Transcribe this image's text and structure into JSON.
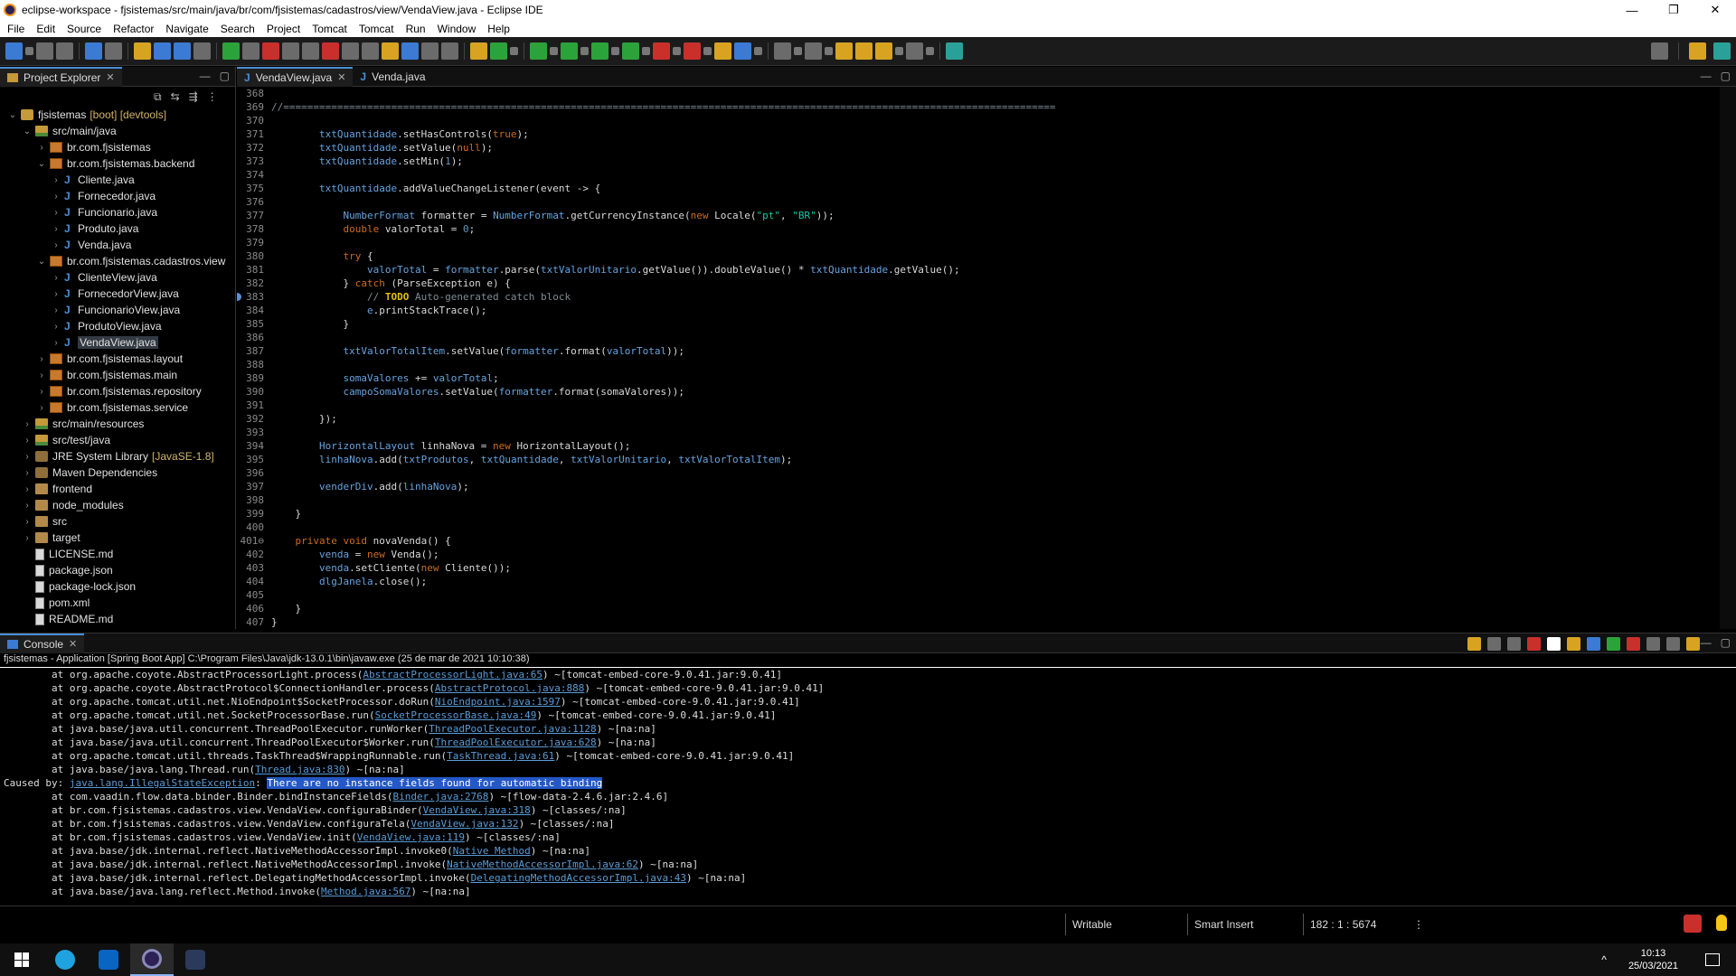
{
  "window": {
    "title": "eclipse-workspace - fjsistemas/src/main/java/br/com/fjsistemas/cadastros/view/VendaView.java - Eclipse IDE",
    "minimize": "—",
    "restore": "❐",
    "close": "✕"
  },
  "menu": [
    "File",
    "Edit",
    "Source",
    "Refactor",
    "Navigate",
    "Search",
    "Project",
    "Tomcat",
    "Tomcat",
    "Run",
    "Window",
    "Help"
  ],
  "explorer": {
    "tab_label": "Project Explorer",
    "tree": [
      {
        "depth": 0,
        "twisty": "v",
        "icon": "project",
        "label": "fjsistemas",
        "decoration": "[boot] [devtools]"
      },
      {
        "depth": 1,
        "twisty": "v",
        "icon": "srcfolder",
        "label": "src/main/java"
      },
      {
        "depth": 2,
        "twisty": ">",
        "icon": "package",
        "label": "br.com.fjsistemas"
      },
      {
        "depth": 2,
        "twisty": "v",
        "icon": "package",
        "label": "br.com.fjsistemas.backend"
      },
      {
        "depth": 3,
        "twisty": ">",
        "icon": "java",
        "label": "Cliente.java"
      },
      {
        "depth": 3,
        "twisty": ">",
        "icon": "java",
        "label": "Fornecedor.java"
      },
      {
        "depth": 3,
        "twisty": ">",
        "icon": "java",
        "label": "Funcionario.java"
      },
      {
        "depth": 3,
        "twisty": ">",
        "icon": "java",
        "label": "Produto.java"
      },
      {
        "depth": 3,
        "twisty": ">",
        "icon": "java",
        "label": "Venda.java"
      },
      {
        "depth": 2,
        "twisty": "v",
        "icon": "package",
        "label": "br.com.fjsistemas.cadastros.view"
      },
      {
        "depth": 3,
        "twisty": ">",
        "icon": "java",
        "label": "ClienteView.java"
      },
      {
        "depth": 3,
        "twisty": ">",
        "icon": "java",
        "label": "FornecedorView.java"
      },
      {
        "depth": 3,
        "twisty": ">",
        "icon": "java",
        "label": "FuncionarioView.java"
      },
      {
        "depth": 3,
        "twisty": ">",
        "icon": "java",
        "label": "ProdutoView.java"
      },
      {
        "depth": 3,
        "twisty": ">",
        "icon": "java",
        "label": "VendaView.java",
        "selected": true
      },
      {
        "depth": 2,
        "twisty": ">",
        "icon": "package",
        "label": "br.com.fjsistemas.layout"
      },
      {
        "depth": 2,
        "twisty": ">",
        "icon": "package",
        "label": "br.com.fjsistemas.main"
      },
      {
        "depth": 2,
        "twisty": ">",
        "icon": "package",
        "label": "br.com.fjsistemas.repository"
      },
      {
        "depth": 2,
        "twisty": ">",
        "icon": "package",
        "label": "br.com.fjsistemas.service"
      },
      {
        "depth": 1,
        "twisty": ">",
        "icon": "srcfolder",
        "label": "src/main/resources"
      },
      {
        "depth": 1,
        "twisty": ">",
        "icon": "srcfolder",
        "label": "src/test/java"
      },
      {
        "depth": 1,
        "twisty": ">",
        "icon": "library",
        "label": "JRE System Library",
        "decoration": "[JavaSE-1.8]"
      },
      {
        "depth": 1,
        "twisty": ">",
        "icon": "library",
        "label": "Maven Dependencies"
      },
      {
        "depth": 1,
        "twisty": ">",
        "icon": "folder",
        "label": "frontend"
      },
      {
        "depth": 1,
        "twisty": ">",
        "icon": "folder",
        "label": "node_modules"
      },
      {
        "depth": 1,
        "twisty": ">",
        "icon": "folder",
        "label": "src"
      },
      {
        "depth": 1,
        "twisty": ">",
        "icon": "folder",
        "label": "target"
      },
      {
        "depth": 1,
        "twisty": "",
        "icon": "file",
        "label": "LICENSE.md"
      },
      {
        "depth": 1,
        "twisty": "",
        "icon": "file",
        "label": "package.json"
      },
      {
        "depth": 1,
        "twisty": "",
        "icon": "file",
        "label": "package-lock.json"
      },
      {
        "depth": 1,
        "twisty": "",
        "icon": "file",
        "label": "pom.xml"
      },
      {
        "depth": 1,
        "twisty": "",
        "icon": "file",
        "label": "README.md"
      }
    ]
  },
  "editor": {
    "tabs": [
      {
        "label": "VendaView.java",
        "active": true
      },
      {
        "label": "Venda.java",
        "active": false
      }
    ],
    "lines": [
      {
        "n": "368",
        "html": ""
      },
      {
        "n": "369",
        "html": "<span class='cmt'>//=================================================================================================================================</span>"
      },
      {
        "n": "370",
        "html": ""
      },
      {
        "n": "371",
        "html": "        <span class='fld'>txtQuantidade</span>.setHasControls(<span class='kw'>true</span>);"
      },
      {
        "n": "372",
        "html": "        <span class='fld'>txtQuantidade</span>.setValue(<span class='kw'>null</span>);"
      },
      {
        "n": "373",
        "html": "        <span class='fld'>txtQuantidade</span>.setMin(<span class='num'>1</span>);"
      },
      {
        "n": "374",
        "html": ""
      },
      {
        "n": "375",
        "html": "        <span class='fld'>txtQuantidade</span>.addValueChangeListener(event -&gt; {"
      },
      {
        "n": "376",
        "html": ""
      },
      {
        "n": "377",
        "html": "            <span class='fld'>NumberFormat</span> formatter = <span class='fld'>NumberFormat</span>.getCurrencyInstance(<span class='kw'>new</span> Locale(<span class='str'>\"pt\"</span>, <span class='str'>\"BR\"</span>));"
      },
      {
        "n": "378",
        "html": "            <span class='kw'>double</span> valorTotal = <span class='num'>0</span>;"
      },
      {
        "n": "379",
        "html": ""
      },
      {
        "n": "380",
        "html": "            <span class='kw'>try</span> {"
      },
      {
        "n": "381",
        "html": "                <span class='fld'>valorTotal</span> = <span class='fld'>formatter</span>.parse(<span class='fld'>txtValorUnitario</span>.getValue()).doubleValue() * <span class='fld'>txtQuantidade</span>.getValue();"
      },
      {
        "n": "382",
        "html": "            } <span class='kw'>catch</span> (ParseException e) {"
      },
      {
        "n": "383",
        "html": "                <span class='cmt'>// <span class='tag'>TODO</span> Auto-generated catch block</span>",
        "marker": true
      },
      {
        "n": "384",
        "html": "                <span class='fld'>e</span>.printStackTrace();"
      },
      {
        "n": "385",
        "html": "            }"
      },
      {
        "n": "386",
        "html": ""
      },
      {
        "n": "387",
        "html": "            <span class='fld'>txtValorTotalItem</span>.setValue(<span class='fld'>formatter</span>.format(<span class='fld'>valorTotal</span>));"
      },
      {
        "n": "388",
        "html": ""
      },
      {
        "n": "389",
        "html": "            <span class='fld'>somaValores</span> += <span class='fld'>valorTotal</span>;"
      },
      {
        "n": "390",
        "html": "            <span class='fld'>campoSomaValores</span>.setValue(<span class='fld'>formatter</span>.format(somaValores));"
      },
      {
        "n": "391",
        "html": ""
      },
      {
        "n": "392",
        "html": "        });"
      },
      {
        "n": "393",
        "html": ""
      },
      {
        "n": "394",
        "html": "        <span class='fld'>HorizontalLayout</span> linhaNova = <span class='kw'>new</span> HorizontalLayout();"
      },
      {
        "n": "395",
        "html": "        <span class='fld'>linhaNova</span>.add(<span class='fld'>txtProdutos</span>, <span class='fld'>txtQuantidade</span>, <span class='fld'>txtValorUnitario</span>, <span class='fld'>txtValorTotalItem</span>);"
      },
      {
        "n": "396",
        "html": ""
      },
      {
        "n": "397",
        "html": "        <span class='fld'>venderDiv</span>.add(<span class='fld'>linhaNova</span>);"
      },
      {
        "n": "398",
        "html": ""
      },
      {
        "n": "399",
        "html": "    }"
      },
      {
        "n": "400",
        "html": ""
      },
      {
        "n": "401⊖",
        "html": "    <span class='kw'>private</span> <span class='kw'>void</span> novaVenda() {"
      },
      {
        "n": "402",
        "html": "        <span class='fld'>venda</span> = <span class='kw'>new</span> Venda();"
      },
      {
        "n": "403",
        "html": "        <span class='fld'>venda</span>.setCliente(<span class='kw'>new</span> Cliente());"
      },
      {
        "n": "404",
        "html": "        <span class='fld'>dlgJanela</span>.close();"
      },
      {
        "n": "405",
        "html": ""
      },
      {
        "n": "406",
        "html": "    }"
      },
      {
        "n": "407",
        "html": "}"
      }
    ]
  },
  "console": {
    "tab_label": "Console",
    "process": "fjsistemas - Application [Spring Boot App] C:\\Program Files\\Java\\jdk-13.0.1\\bin\\javaw.exe  (25 de mar de 2021 10:10:38)",
    "lines": [
      {
        "text": "        at org.apache.coyote.AbstractProcessorLight.process(<span class='link'>AbstractProcessorLight.java:65</span>) ~[tomcat-embed-core-9.0.41.jar:9.0.41]"
      },
      {
        "text": "        at org.apache.coyote.AbstractProtocol$ConnectionHandler.process(<span class='link'>AbstractProtocol.java:888</span>) ~[tomcat-embed-core-9.0.41.jar:9.0.41]"
      },
      {
        "text": "        at org.apache.tomcat.util.net.NioEndpoint$SocketProcessor.doRun(<span class='link'>NioEndpoint.java:1597</span>) ~[tomcat-embed-core-9.0.41.jar:9.0.41]"
      },
      {
        "text": "        at org.apache.tomcat.util.net.SocketProcessorBase.run(<span class='link'>SocketProcessorBase.java:49</span>) ~[tomcat-embed-core-9.0.41.jar:9.0.41]"
      },
      {
        "text": "        at java.base/java.util.concurrent.ThreadPoolExecutor.runWorker(<span class='link'>ThreadPoolExecutor.java:1128</span>) ~[na:na]"
      },
      {
        "text": "        at java.base/java.util.concurrent.ThreadPoolExecutor$Worker.run(<span class='link'>ThreadPoolExecutor.java:628</span>) ~[na:na]"
      },
      {
        "text": "        at org.apache.tomcat.util.threads.TaskThread$WrappingRunnable.run(<span class='link'>TaskThread.java:61</span>) ~[tomcat-embed-core-9.0.41.jar:9.0.41]"
      },
      {
        "text": "        at java.base/java.lang.Thread.run(<span class='link'>Thread.java:830</span>) ~[na:na]"
      },
      {
        "text": "Caused by: <span class='link'>java.lang.IllegalStateException</span>: <span class='hl'>There are no instance fields found for automatic binding</span>"
      },
      {
        "text": "        at com.vaadin.flow.data.binder.Binder.bindInstanceFields(<span class='link'>Binder.java:2768</span>) ~[flow-data-2.4.6.jar:2.4.6]"
      },
      {
        "text": "        at br.com.fjsistemas.cadastros.view.VendaView.configuraBinder(<span class='link'>VendaView.java:318</span>) ~[classes/:na]"
      },
      {
        "text": "        at br.com.fjsistemas.cadastros.view.VendaView.configuraTela(<span class='link'>VendaView.java:132</span>) ~[classes/:na]"
      },
      {
        "text": "        at br.com.fjsistemas.cadastros.view.VendaView.init(<span class='link'>VendaView.java:119</span>) ~[classes/:na]"
      },
      {
        "text": "        at java.base/jdk.internal.reflect.NativeMethodAccessorImpl.invoke0(<span class='link'>Native Method</span>) ~[na:na]"
      },
      {
        "text": "        at java.base/jdk.internal.reflect.NativeMethodAccessorImpl.invoke(<span class='link'>NativeMethodAccessorImpl.java:62</span>) ~[na:na]"
      },
      {
        "text": "        at java.base/jdk.internal.reflect.DelegatingMethodAccessorImpl.invoke(<span class='link'>DelegatingMethodAccessorImpl.java:43</span>) ~[na:na]"
      },
      {
        "text": "        at java.base/java.lang.reflect.Method.invoke(<span class='link'>Method.java:567</span>) ~[na:na]"
      }
    ]
  },
  "status": {
    "writable": "Writable",
    "insert_mode": "Smart Insert",
    "position": "182 : 1 : 5674"
  },
  "taskbar": {
    "time": "10:13",
    "date": "25/03/2021"
  },
  "colors": {
    "background": "#000000",
    "keyword": "#cc6c1d",
    "field": "#66a3e0",
    "string": "#17c6a3",
    "link": "#5b9bd5",
    "highlight": "#2458c7"
  }
}
